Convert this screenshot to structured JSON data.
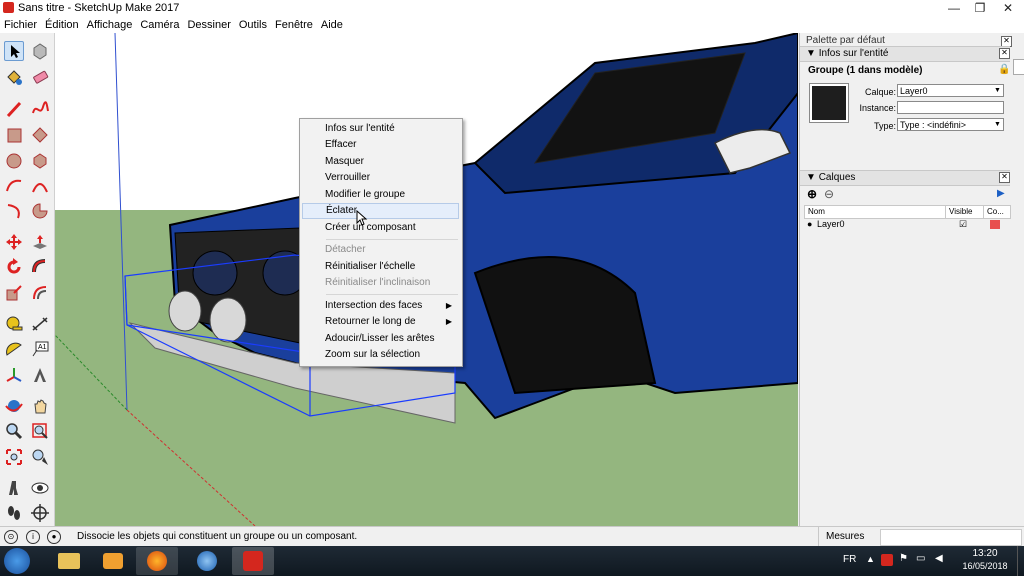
{
  "window": {
    "title": "Sans titre - SketchUp Make 2017",
    "min": "—",
    "max": "❐",
    "close": "✕"
  },
  "menu": [
    "Fichier",
    "Édition",
    "Affichage",
    "Caméra",
    "Dessiner",
    "Outils",
    "Fenêtre",
    "Aide"
  ],
  "context_menu": {
    "items": [
      "Infos sur l'entité",
      "Effacer",
      "Masquer",
      "Verrouiller",
      "Modifier le groupe",
      "Éclater",
      "Créer un composant",
      "Détacher",
      "Réinitialiser l'échelle",
      "Réinitialiser l'inclinaison",
      "Intersection des faces",
      "Retourner le long de",
      "Adoucir/Lisser les arêtes",
      "Zoom sur la sélection"
    ]
  },
  "panel": {
    "title": "Palette par défaut",
    "entity_section": "Infos sur l'entité",
    "entity_name": "Groupe (1 dans modèle)",
    "layer_label": "Calque:",
    "layer_value": "Layer0",
    "instance_label": "Instance:",
    "instance_value": "",
    "type_label": "Type:",
    "type_value": "Type : <indéfini>",
    "layers_section": "Calques",
    "col_name": "Nom",
    "col_visible": "Visible",
    "col_color": "Co...",
    "layer_row": "Layer0",
    "layer_color": "#e8504f",
    "visible_check": "☑"
  },
  "status": {
    "text": "Dissocie les objets qui constituent un groupe ou un composant.",
    "measures_label": "Mesures"
  },
  "taskbar": {
    "lang": "FR",
    "time": "13:20",
    "date": "16/05/2018"
  }
}
